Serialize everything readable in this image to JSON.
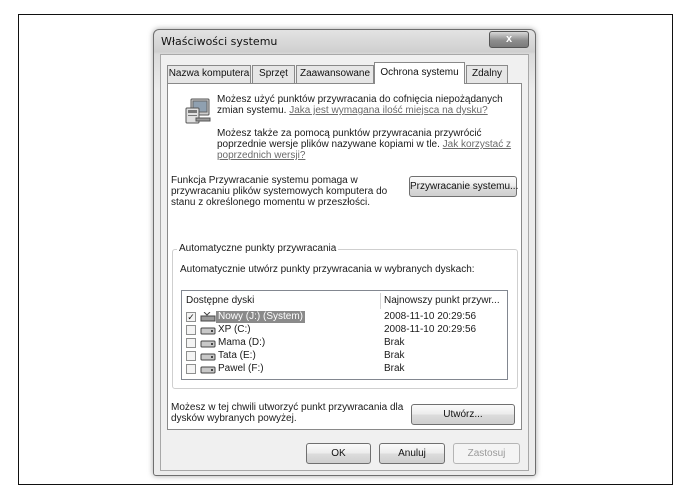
{
  "window": {
    "title": "Właściwości systemu",
    "close_label": "x"
  },
  "tabs": [
    {
      "label": "Nazwa komputera",
      "active": false
    },
    {
      "label": "Sprzęt",
      "active": false
    },
    {
      "label": "Zaawansowane",
      "active": false
    },
    {
      "label": "Ochrona systemu",
      "active": true
    },
    {
      "label": "Zdalny",
      "active": false
    }
  ],
  "protection": {
    "intro_text": "Możesz użyć punktów przywracania do cofnięcia niepożądanych zmian systemu.",
    "intro_link": "Jaka jest wymagana ilość miejsca na dysku?",
    "prev_text": "Możesz także za pomocą punktów przywracania przywrócić poprzednie wersje plików nazywane kopiami w tle.",
    "prev_link": "Jak korzystać z poprzednich wersji?",
    "restore_text": "Funkcja Przywracanie systemu pomaga w przywracaniu plików systemowych komputera do stanu z określonego momentu w przeszłości.",
    "restore_button": "Przywracanie systemu...",
    "group_title": "Automatyczne punkty przywracania",
    "group_desc": "Automatycznie utwórz punkty przywracania w wybranych dyskach:",
    "col_drives": "Dostępne dyski",
    "col_latest": "Najnowszy punkt przywr...",
    "drives": [
      {
        "name": "Nowy (J:) (System)",
        "latest": "2008-11-10 20:29:56",
        "checked": true,
        "selected": true
      },
      {
        "name": "XP (C:)",
        "latest": "2008-11-10 20:29:56",
        "checked": false,
        "selected": false
      },
      {
        "name": "Mama (D:)",
        "latest": "Brak",
        "checked": false,
        "selected": false
      },
      {
        "name": "Tata (E:)",
        "latest": "Brak",
        "checked": false,
        "selected": false
      },
      {
        "name": "Pawel (F:)",
        "latest": "Brak",
        "checked": false,
        "selected": false
      }
    ],
    "create_text": "Możesz w tej chwili utworzyć punkt przywracania dla dysków wybranych powyżej.",
    "create_button": "Utwórz..."
  },
  "footer": {
    "ok": "OK",
    "cancel": "Anuluj",
    "apply": "Zastosuj"
  },
  "check_mark": "✓"
}
